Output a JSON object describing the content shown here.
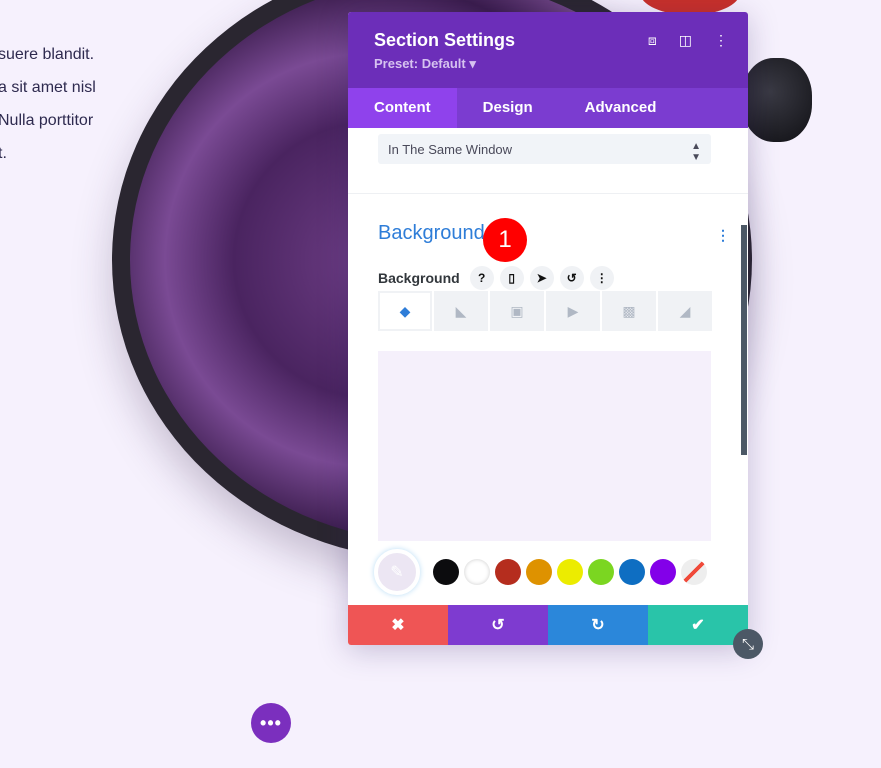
{
  "page_text": [
    "suere blandit.",
    "a sit amet nisl",
    "Nulla porttitor",
    "t."
  ],
  "modal": {
    "title": "Section Settings",
    "preset": "Preset: Default ▾",
    "icons": [
      "focus-icon",
      "sidebar-layout-icon",
      "more-vertical-icon"
    ],
    "tabs": [
      {
        "label": "Content",
        "active": true
      },
      {
        "label": "Design"
      },
      {
        "label": "Advanced"
      }
    ],
    "link_target_value": "In The Same Window",
    "section_title": "Background",
    "field_label": "Background",
    "field_icons": {
      "help": "?",
      "responsive": "▯",
      "hover": "➤",
      "reset": "↺",
      "more": "⋮"
    },
    "bg_types": [
      "color",
      "gradient",
      "image",
      "video",
      "pattern",
      "mask"
    ],
    "swatches": [
      "#0c0c0e",
      "#ffffff",
      "#b52d1e",
      "#de9200",
      "#ecec00",
      "#7bd621",
      "#0e6ec2",
      "#8300e9",
      "transparent"
    ],
    "footer": {
      "cancel": "✖",
      "undo": "↺",
      "redo": "↻",
      "save": "✔"
    },
    "footer_colors": [
      "#ef5555",
      "#7e3bd0",
      "#2b87da",
      "#29c4a9"
    ]
  },
  "badge": "1",
  "more_button": "•••"
}
